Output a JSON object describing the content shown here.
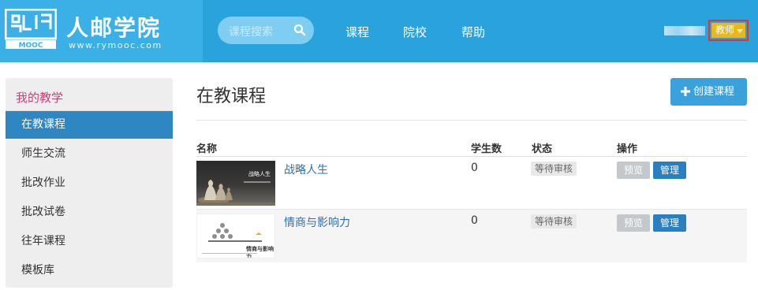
{
  "header": {
    "logo_letters": "MOOC",
    "logo_title": "人邮学院",
    "logo_url": "www.rymooc.com",
    "search_placeholder": "课程搜索",
    "nav": [
      "课程",
      "院校",
      "帮助"
    ],
    "role_label": "教师",
    "colors": {
      "bar": "#2aa2dc",
      "role": "#e9b91b",
      "highlight": "#e0342f"
    }
  },
  "sidebar": {
    "heading": "我的教学",
    "items": [
      {
        "label": "在教课程",
        "active": true
      },
      {
        "label": "师生交流",
        "active": false
      },
      {
        "label": "批改作业",
        "active": false
      },
      {
        "label": "批改试卷",
        "active": false
      },
      {
        "label": "往年课程",
        "active": false
      },
      {
        "label": "模板库",
        "active": false
      }
    ]
  },
  "main": {
    "title": "在教课程",
    "create_label": "创建课程",
    "columns": {
      "name": "名称",
      "students": "学生数",
      "status": "状态",
      "ops": "操作"
    },
    "courses": [
      {
        "name": "战略人生",
        "students": "0",
        "status": "等待审核",
        "preview": "预览",
        "manage": "管理",
        "thumb_text": "战略人生"
      },
      {
        "name": "情商与影响力",
        "students": "0",
        "status": "等待审核",
        "preview": "预览",
        "manage": "管理",
        "thumb_text": "情商与影响力"
      }
    ]
  }
}
